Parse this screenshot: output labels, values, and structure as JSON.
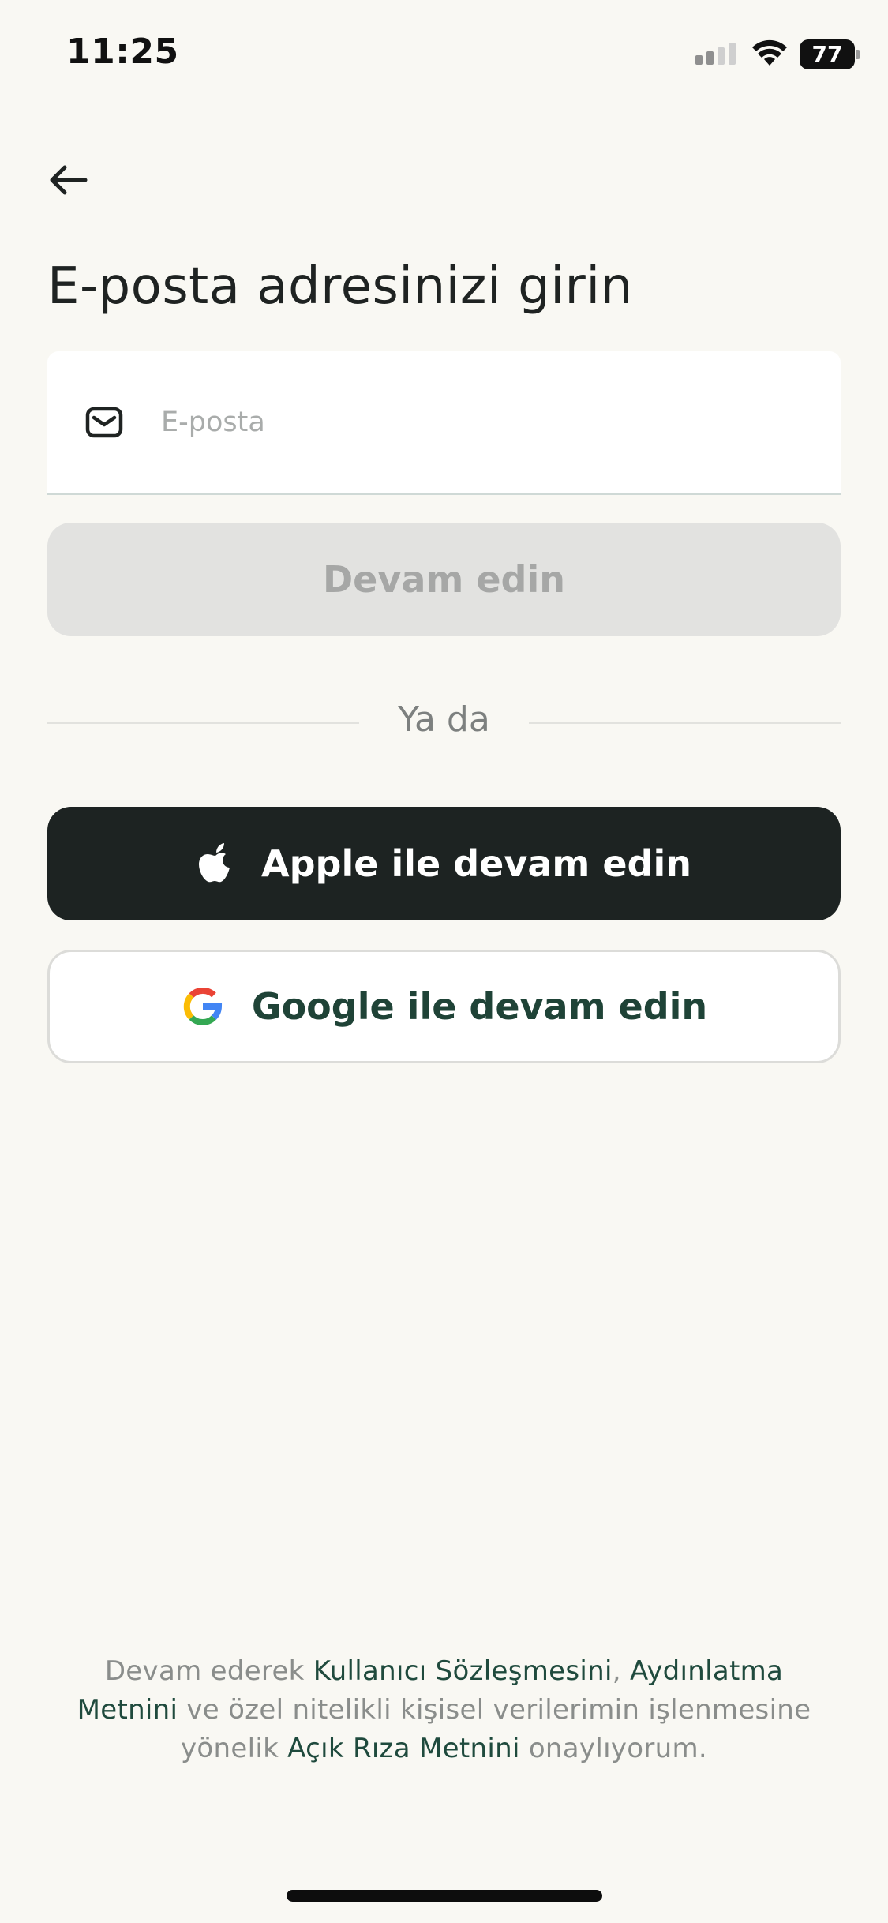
{
  "status_bar": {
    "time": "11:25",
    "battery": "77"
  },
  "title": "E-posta adresinizi girin",
  "email_field": {
    "value": "",
    "placeholder": "E-posta",
    "icon": "mail-icon"
  },
  "continue_button": {
    "label": "Devam edin",
    "state": "disabled"
  },
  "divider_text": "Ya da",
  "apple_button": {
    "label": "Apple ile devam edin",
    "icon": "apple-logo-icon"
  },
  "google_button": {
    "label": "Google ile devam edin",
    "icon": "google-logo-icon"
  },
  "legal": {
    "prefix": "Devam ederek ",
    "link_user_agreement": "Kullanıcı Sözleşmesini",
    "comma": ", ",
    "link_disclosure": "Aydınlatma Metnini",
    "middle": " ve özel nitelikli kişisel verilerimin işlenmesine yönelik ",
    "link_consent": "Açık Rıza Metnini",
    "suffix": " onaylıyorum."
  },
  "colors": {
    "background": "#f9f8f3",
    "apple_button": "#1d2322",
    "link": "#1f4a3d",
    "disabled_button": "#e2e2e0"
  }
}
